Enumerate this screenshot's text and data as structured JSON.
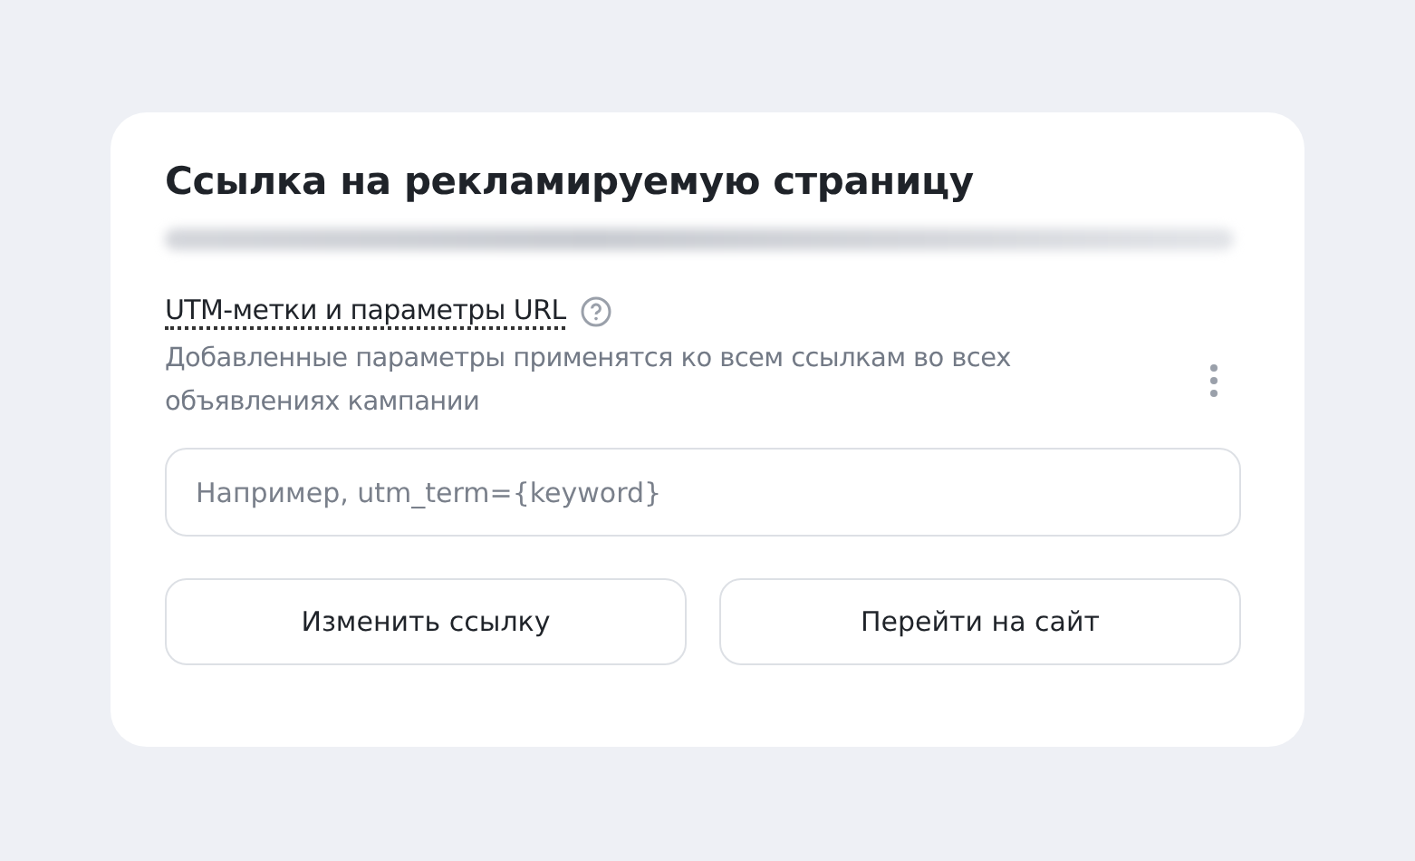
{
  "card": {
    "title": "Ссылка на рекламируемую страницу",
    "utm": {
      "label": "UTM-метки и параметры URL",
      "description": "Добавленные параметры применятся ко всем ссылкам во всех объявлениях кампании"
    },
    "field": {
      "placeholder": "Например, utm_term={keyword}"
    },
    "buttons": [
      "Изменить ссылку",
      "Перейти на сайт"
    ]
  }
}
